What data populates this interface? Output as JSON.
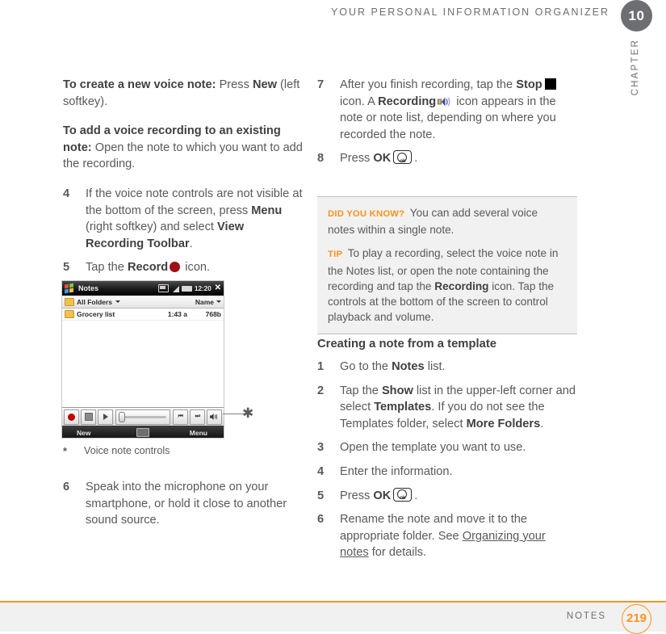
{
  "header": {
    "title": "YOUR PERSONAL INFORMATION ORGANIZER",
    "chapter_number": "10",
    "chapter_word": "CHAPTER"
  },
  "left_column": {
    "paragraphs": [
      {
        "bold_lead": "To create a new voice note:",
        "text_after": " Press ",
        "bold_mid": "New",
        "text_end": " (left softkey)."
      },
      {
        "bold_lead": "To add a voice recording to an existing note:",
        "text_after": " Open the note to which you want to add the recording.",
        "bold_mid": "",
        "text_end": ""
      }
    ],
    "steps": [
      {
        "num": "4",
        "seg1": "If the voice note controls are not visible at the bottom of the screen, press ",
        "b1": "Menu",
        "seg2": " (right softkey) and select ",
        "b2": "View Recording Toolbar",
        "seg3": "."
      },
      {
        "num": "5",
        "seg1": "Tap the ",
        "b1": "Record",
        "seg2": "",
        "b2": "",
        "seg3": " icon."
      }
    ],
    "caption": {
      "marker": "*",
      "text": "Voice note controls"
    },
    "step6": {
      "num": "6",
      "text": "Speak into the microphone on your smartphone, or hold it close to another sound source."
    }
  },
  "device": {
    "title": "Notes",
    "time": "12:20",
    "close_glyph": "✕",
    "folder_label": "All Folders",
    "sort_label": "Name",
    "rows": [
      {
        "name": "Grocery list",
        "time": "1:43 a",
        "size": "768b"
      }
    ],
    "softkeys": {
      "left": "New",
      "right": "Menu"
    },
    "toolbar": {
      "record": "record-button",
      "stop": "stop-button",
      "play": "play-button",
      "prev": "⏮",
      "next": "⏭",
      "volume": "volume-button"
    }
  },
  "right_column": {
    "steps": [
      {
        "num": "7",
        "seg1": "After you finish recording, tap the ",
        "b1": "Stop",
        "seg2": " icon. A ",
        "b2": "Recording",
        "seg3": " icon appears in the note or note list, depending on where you recorded the note."
      },
      {
        "num": "8",
        "seg1": "Press ",
        "b1": "OK",
        "seg2": "",
        "b2": "",
        "seg3": "."
      }
    ],
    "tipbox": [
      {
        "label": "DID YOU KNOW?",
        "text": " You can add several voice notes within a single note."
      },
      {
        "label": "TIP",
        "seg1": " To play a recording, select the voice note in the Notes list, or open the note containing the recording and tap the ",
        "bold": "Recording",
        "seg2": " icon. Tap the controls at the bottom of the screen to control playback and volume."
      }
    ],
    "subhead": "Creating a note from a template",
    "template_steps": [
      {
        "num": "1",
        "seg1": "Go to the ",
        "b1": "Notes",
        "seg2": " list.",
        "b2": "",
        "seg3": ""
      },
      {
        "num": "2",
        "seg1": "Tap the ",
        "b1": "Show",
        "seg2": " list in the upper-left corner and select ",
        "b2": "Templates",
        "seg3": ". If you do not see the Templates folder, select ",
        "b3": "More Folders",
        "seg4": "."
      },
      {
        "num": "3",
        "seg1": "Open the template you want to use.",
        "b1": "",
        "seg2": "",
        "b2": "",
        "seg3": ""
      },
      {
        "num": "4",
        "seg1": "Enter the information.",
        "b1": "",
        "seg2": "",
        "b2": "",
        "seg3": ""
      },
      {
        "num": "5",
        "seg1": "Press ",
        "b1": "OK",
        "seg2": "",
        "b2": "",
        "seg3": "."
      },
      {
        "num": "6",
        "seg1": "Rename the note and move it to the appropriate folder. See ",
        "xref": "Organizing your notes",
        "seg2": " for details."
      }
    ]
  },
  "footer": {
    "label": "NOTES",
    "page": "219"
  },
  "colors": {
    "accent_orange": "#f7941e",
    "body_gray": "#58595b",
    "chapter_gray": "#6d6e71",
    "record_red": "#9d1013"
  }
}
